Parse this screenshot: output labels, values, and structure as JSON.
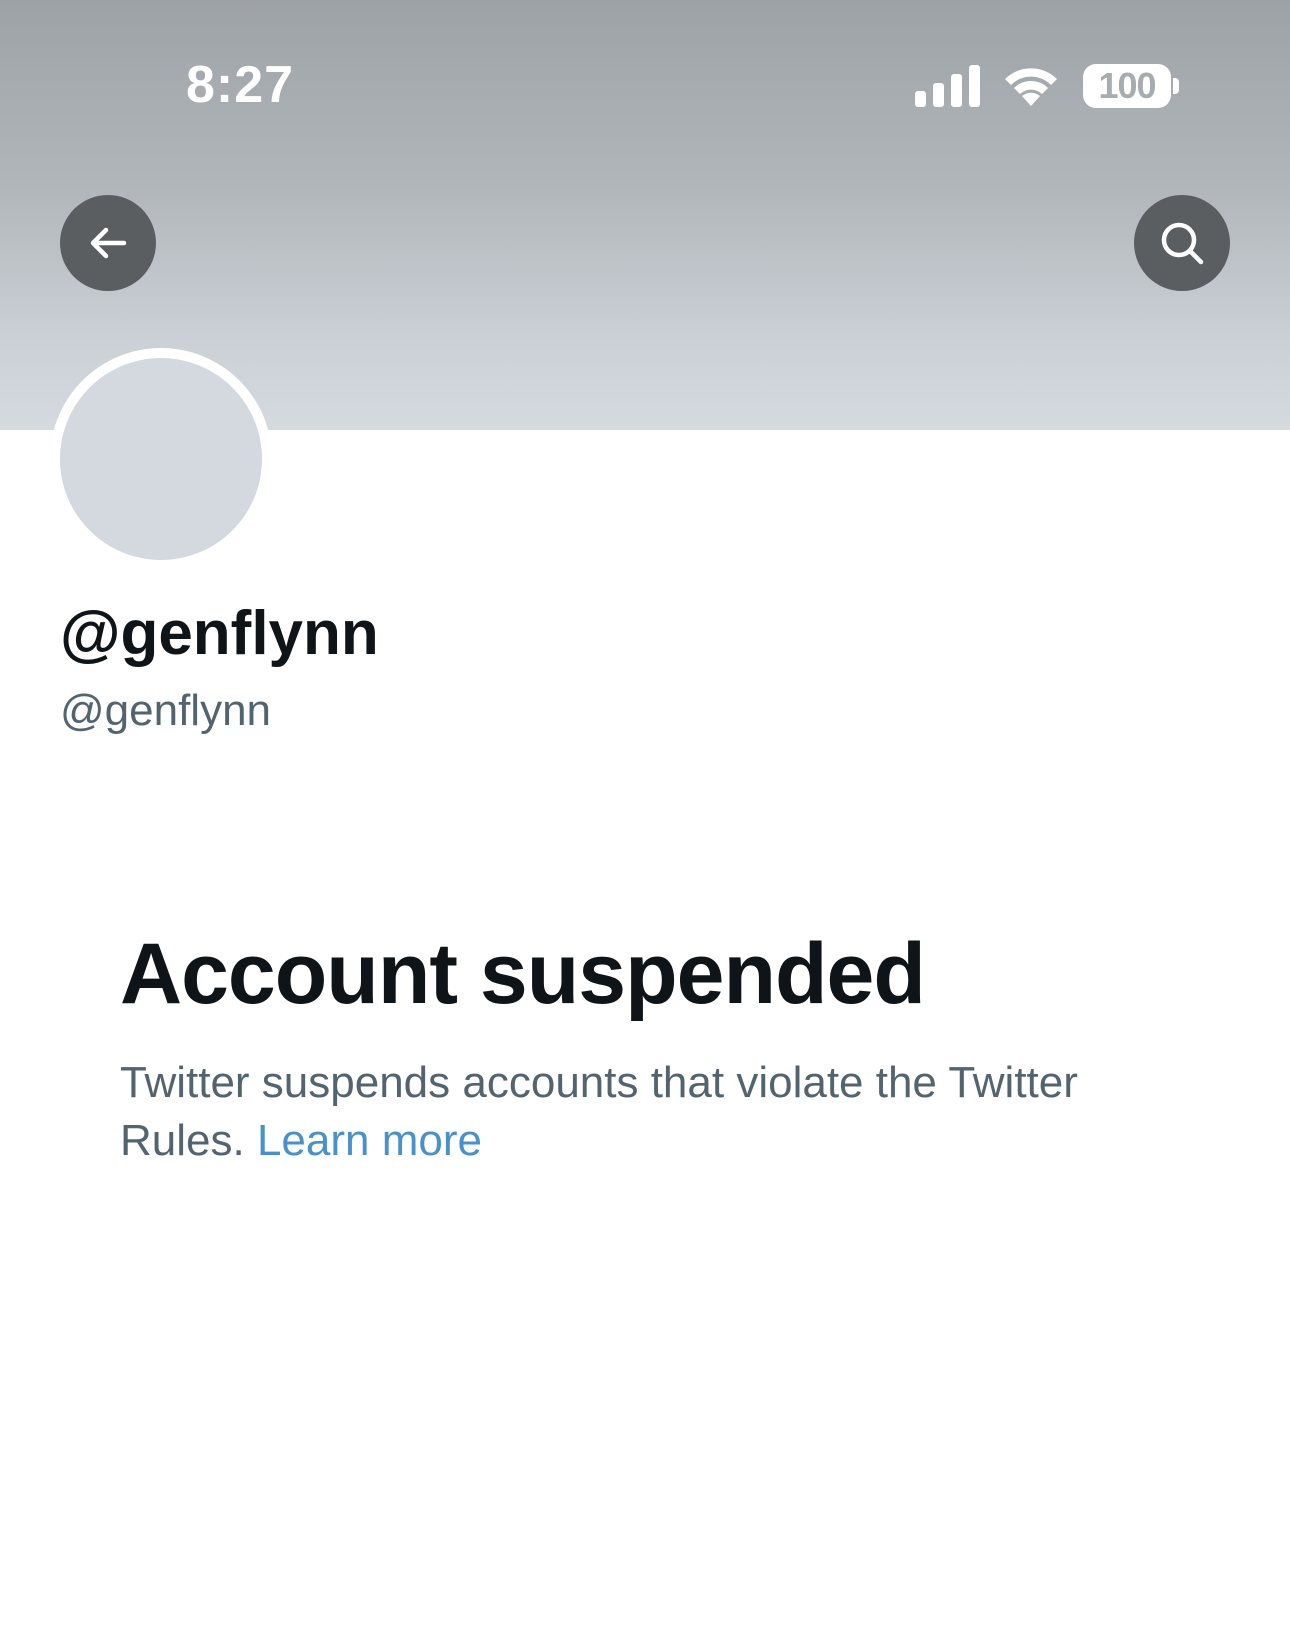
{
  "status_bar": {
    "time": "8:27",
    "battery": "100",
    "icons": [
      "signal-icon",
      "wifi-icon",
      "battery-icon"
    ]
  },
  "header": {
    "back_icon": "arrow-left-icon",
    "search_icon": "search-icon"
  },
  "profile": {
    "display_name": "@genflynn",
    "handle": "@genflynn"
  },
  "notice": {
    "title": "Account suspended",
    "body": "Twitter suspends accounts that violate the Twitter Rules.",
    "link": "Learn more"
  },
  "colors": {
    "text_primary": "#0f1419",
    "text_secondary": "#536471",
    "link": "#4a90c9",
    "avatar_placeholder": "#d3d9de",
    "nav_button": "#5a5e61"
  }
}
